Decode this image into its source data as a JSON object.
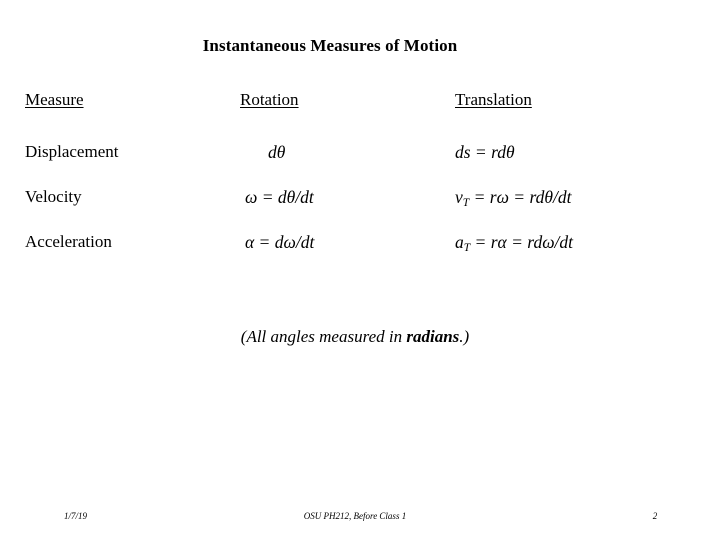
{
  "slide": {
    "title": "Instantaneous Measures of Motion",
    "note_prefix": "(All angles measured in ",
    "note_emphasis": "radians",
    "note_suffix": ".)"
  },
  "table": {
    "headers": {
      "measure": "Measure",
      "rotation": "Rotation",
      "translation": "Translation"
    },
    "rows": [
      {
        "measure": "Displacement",
        "rotation": "dθ",
        "translation_main": "ds  =  rdθ",
        "translation_sub": ""
      },
      {
        "measure": "Velocity",
        "rotation": "ω  =  dθ/dt",
        "translation_lead": "v",
        "translation_sub": "T",
        "translation_main": "  =  rω  =  rdθ/dt"
      },
      {
        "measure": "Acceleration",
        "rotation": "α  =  dω/dt",
        "translation_lead": "a",
        "translation_sub": "T",
        "translation_main": "  =  rα  =  rdω/dt"
      }
    ]
  },
  "footer": {
    "date": "1/7/19",
    "center": "OSU PH212, Before Class 1",
    "page": "2"
  }
}
